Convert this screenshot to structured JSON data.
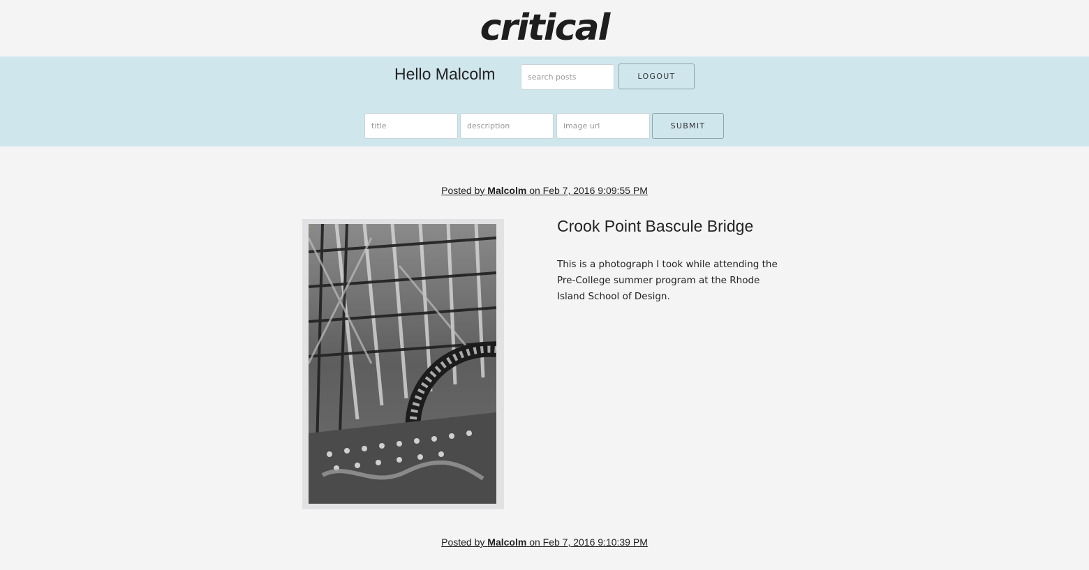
{
  "brand": {
    "logo_text": "critical"
  },
  "header": {
    "greeting": "Hello Malcolm",
    "search_placeholder": "search posts",
    "logout_label": "LOGOUT"
  },
  "new_post_form": {
    "title_placeholder": "title",
    "description_placeholder": "description",
    "image_url_placeholder": "image url",
    "submit_label": "SUBMIT"
  },
  "posts": [
    {
      "posted_by_prefix": "Posted by",
      "author": "Malcolm",
      "date_text": "on Feb 7, 2016 9:09:55 PM",
      "title": "Crook Point Bascule Bridge",
      "description": "This is a photograph I took while attending the Pre-College summer program at the Rhode Island School of Design."
    },
    {
      "posted_by_prefix": "Posted by",
      "author": "Malcolm",
      "date_text": "on Feb 7, 2016 9:10:39 PM"
    }
  ],
  "colors": {
    "page_bg": "#f4f4f4",
    "header_bar_bg": "#cfe6ed",
    "text": "#222222"
  },
  "icons": {
    "post_image": "black-and-white-bridge-photo"
  }
}
